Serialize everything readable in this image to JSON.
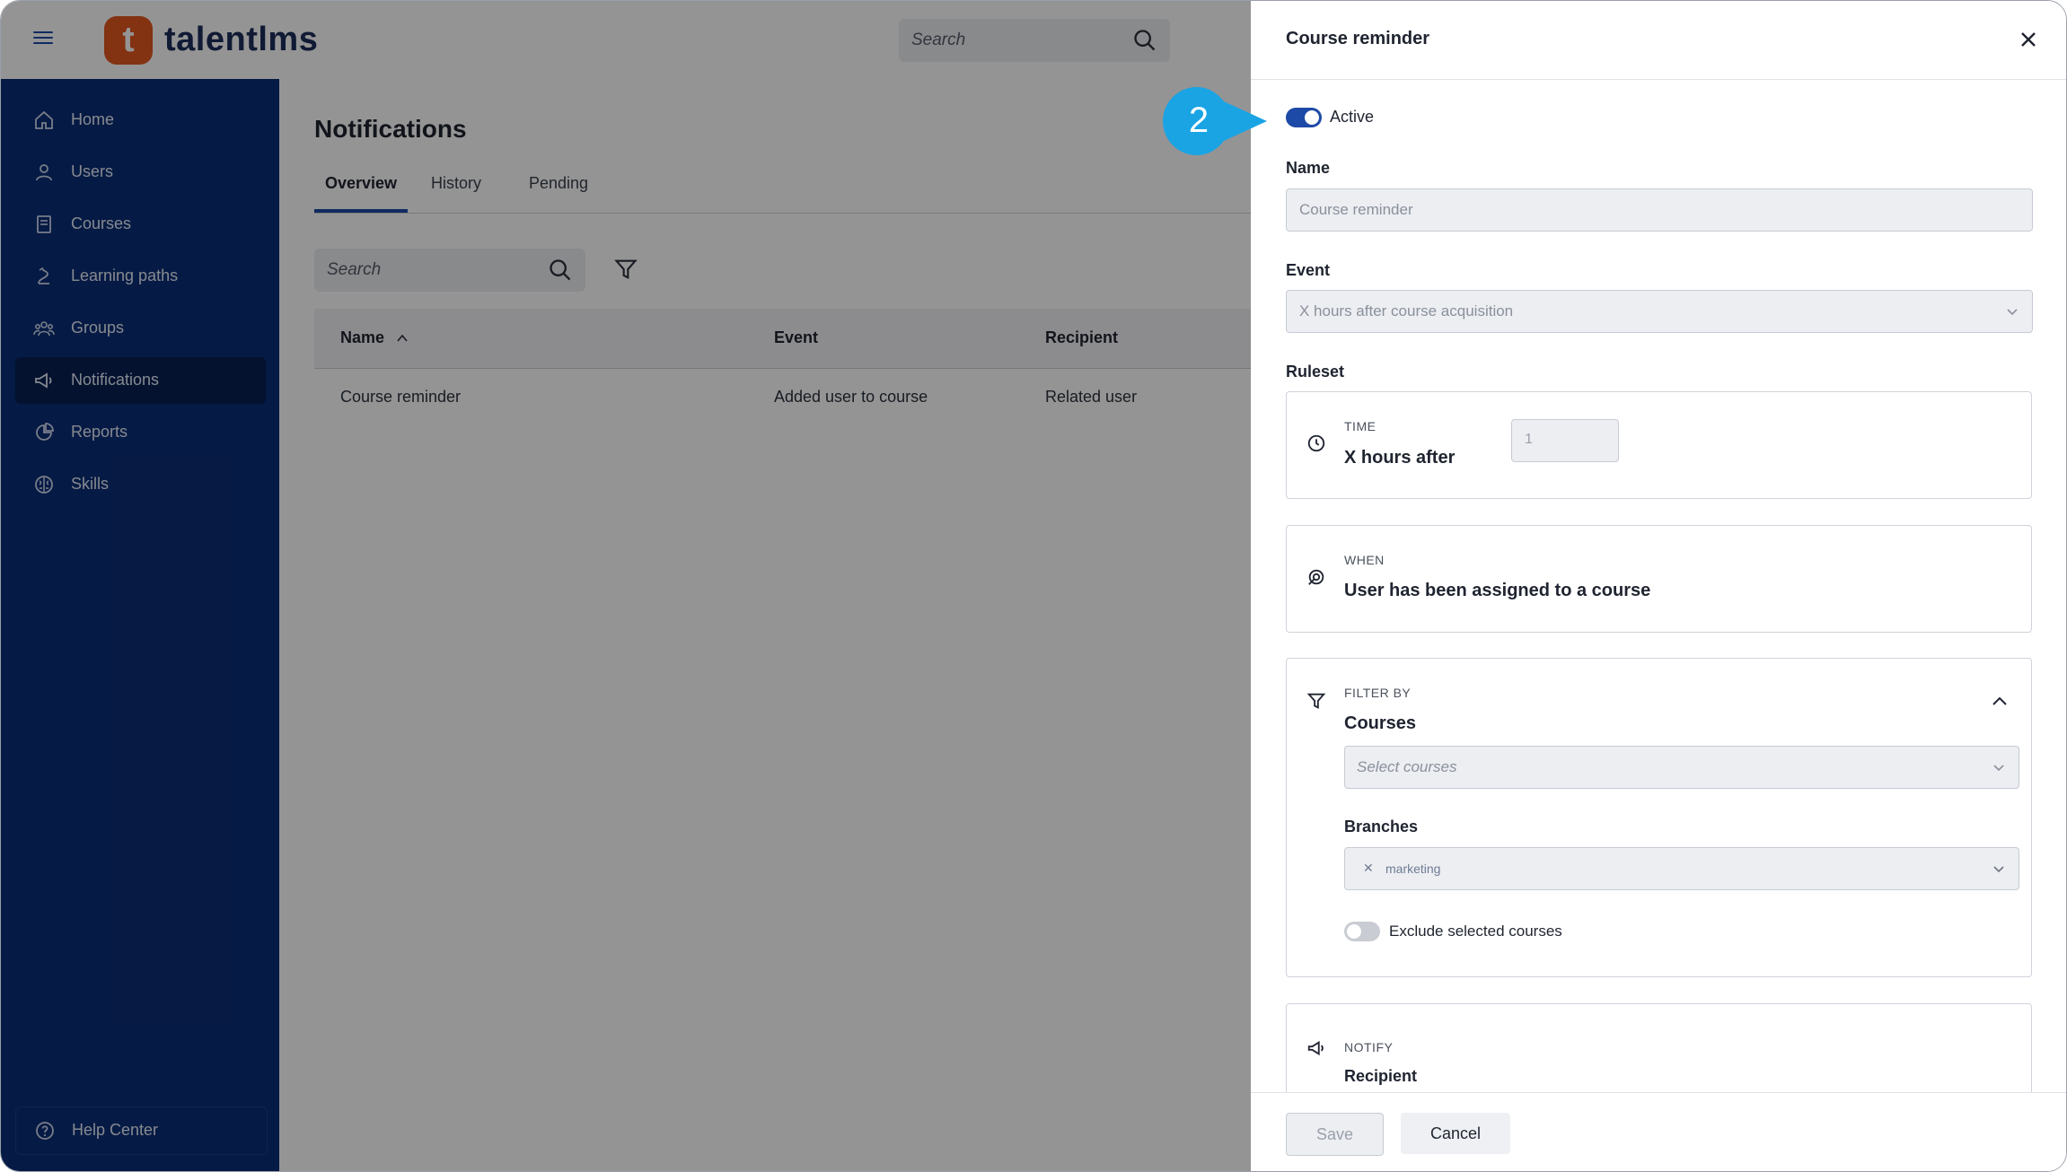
{
  "app": {
    "brand_mark": "t",
    "brand_name": "talentlms",
    "search_placeholder": "Search"
  },
  "sidebar": {
    "items": [
      {
        "label": "Home",
        "icon": "home-icon"
      },
      {
        "label": "Users",
        "icon": "user-icon"
      },
      {
        "label": "Courses",
        "icon": "book-icon"
      },
      {
        "label": "Learning paths",
        "icon": "path-icon"
      },
      {
        "label": "Groups",
        "icon": "groups-icon"
      },
      {
        "label": "Notifications",
        "icon": "megaphone-icon",
        "active": true
      },
      {
        "label": "Reports",
        "icon": "pie-chart-icon"
      },
      {
        "label": "Skills",
        "icon": "brain-icon"
      }
    ],
    "help_label": "Help Center"
  },
  "main": {
    "title": "Notifications",
    "tabs": [
      "Overview",
      "History",
      "Pending"
    ],
    "search_placeholder": "Search",
    "table": {
      "columns": [
        "Name",
        "Event",
        "Recipient"
      ],
      "rows": [
        {
          "name": "Course reminder",
          "event": "Added user to course",
          "recipient": "Related user"
        }
      ]
    }
  },
  "drawer": {
    "title": "Course reminder",
    "active_label": "Active",
    "name_label": "Name",
    "name_value": "Course reminder",
    "event_label": "Event",
    "event_value": "X hours after course acquisition",
    "ruleset_label": "Ruleset",
    "time": {
      "kicker": "TIME",
      "headline": "X hours after",
      "value": "1"
    },
    "when": {
      "kicker": "WHEN",
      "headline": "User has been assigned to a course"
    },
    "filter": {
      "kicker": "FILTER BY",
      "headline": "Courses",
      "courses_placeholder": "Select courses",
      "branches_label": "Branches",
      "branch_chip": "marketing",
      "exclude_label": "Exclude selected courses"
    },
    "notify": {
      "kicker": "NOTIFY",
      "headline": "Recipient"
    },
    "save_label": "Save",
    "cancel_label": "Cancel"
  },
  "callout": {
    "step": "2"
  },
  "colors": {
    "accent": "#1d4aa6",
    "sidebar": "#0a2d75",
    "brand": "#e2561f",
    "callout": "#1aa4e4"
  }
}
